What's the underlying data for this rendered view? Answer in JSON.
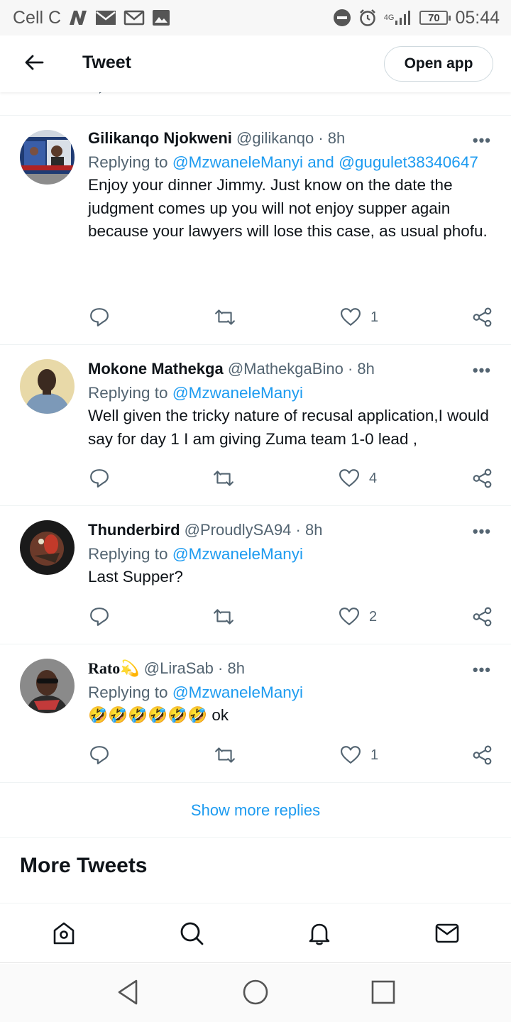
{
  "status_bar": {
    "carrier": "Cell C",
    "network": "4G",
    "battery": "70",
    "time": "05:44",
    "icons": [
      "n-app-icon",
      "message-icon",
      "gmail-icon",
      "gallery-icon",
      "do-not-disturb-icon",
      "alarm-icon",
      "signal-icon",
      "battery-icon"
    ]
  },
  "header": {
    "title": "Tweet",
    "open_app_label": "Open app"
  },
  "tweets": [
    {
      "name": "Gilikanqo Njokweni",
      "handle": "@gilikanqo",
      "time": "· 8h",
      "replying_prefix": "Replying to",
      "mention_1": "@MzwaneleManyi",
      "mention_and": "and",
      "mention_2": "@gugulet38340647",
      "text": "Enjoy your dinner Jimmy. Just know on the date the judgment comes up you will not enjoy supper again because your lawyers will lose this case, as usual phofu.",
      "likes": "1"
    },
    {
      "name": "Mokone Mathekga",
      "handle": "@MathekgaBino",
      "time": "· 8h",
      "replying_prefix": "Replying to",
      "mention_1": "@MzwaneleManyi",
      "text": "Well given the tricky nature of recusal application,I would say for day 1 I am giving Zuma team 1-0 lead ,",
      "likes": "4"
    },
    {
      "name": "Thunderbird",
      "handle": "@ProudlySA94",
      "time": "· 8h",
      "replying_prefix": "Replying to",
      "mention_1": "@MzwaneleManyi",
      "text": "Last Supper?",
      "likes": "2"
    },
    {
      "name": "Rato",
      "name_emoji": "💫",
      "handle": "@LiraSab",
      "time": "· 8h",
      "replying_prefix": "Replying to",
      "mention_1": "@MzwaneleManyi",
      "text": "🤣🤣🤣🤣🤣🤣 ok",
      "likes": "1"
    }
  ],
  "show_more_replies": "Show more replies",
  "more_tweets_heading": "More Tweets",
  "bottom_nav": [
    "home-icon",
    "search-icon",
    "notifications-icon",
    "messages-icon"
  ],
  "system_nav": [
    "back-icon",
    "home-circle-icon",
    "recents-icon"
  ],
  "colors": {
    "accent": "#1d9bf0",
    "text": "#0f1419",
    "secondary": "#536471",
    "divider": "#eff3f4"
  }
}
